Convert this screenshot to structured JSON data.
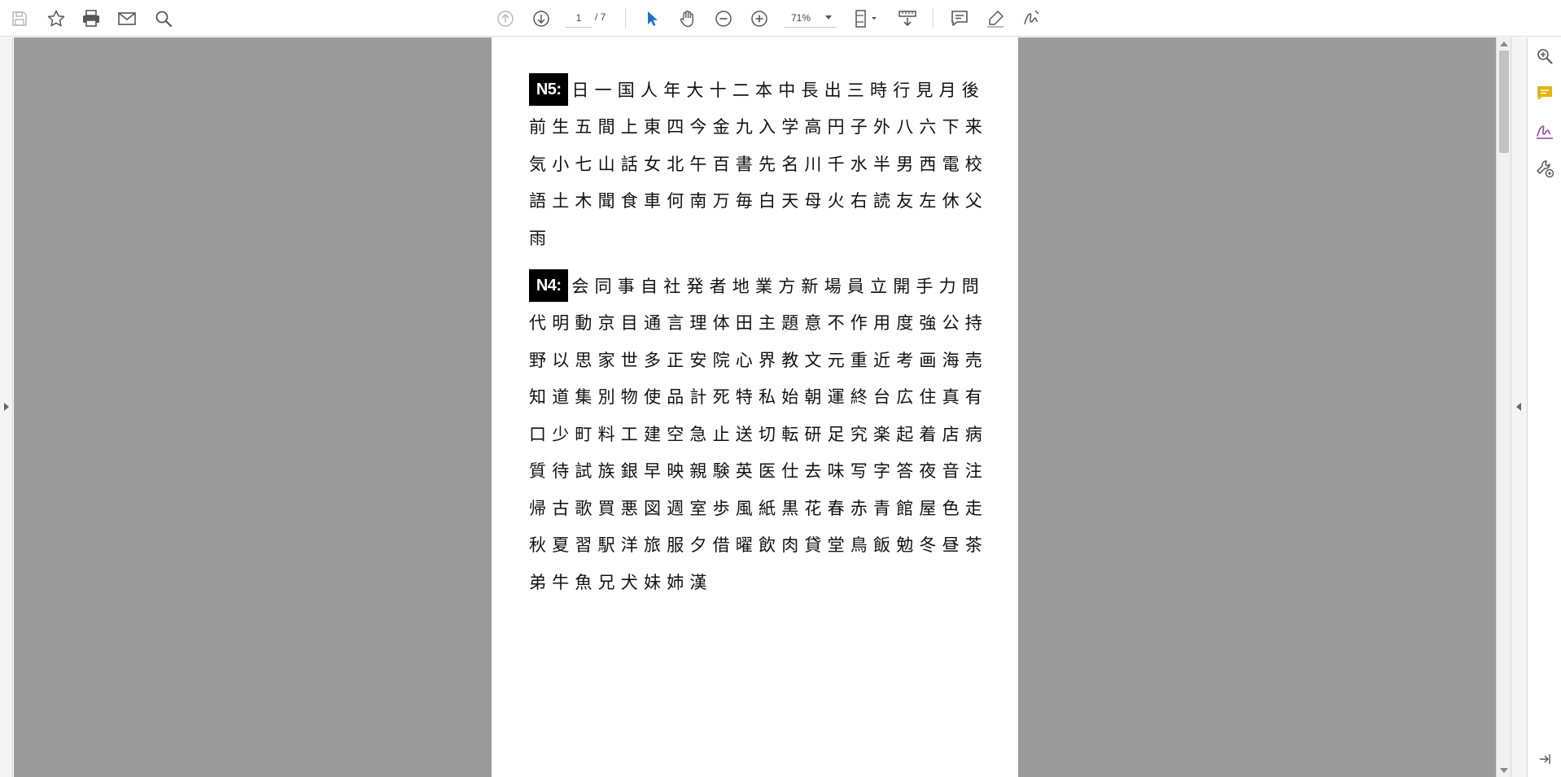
{
  "toolbar": {
    "page_current": "1",
    "page_total": "/ 7",
    "zoom": "71%"
  },
  "icons": {
    "save": "save-icon",
    "bookmark": "star-icon",
    "print": "printer-icon",
    "email": "envelope-icon",
    "search": "magnifier-icon",
    "prev_page": "arrow-up-circle-icon",
    "next_page": "arrow-down-circle-icon",
    "select": "cursor-arrow-icon",
    "hand": "hand-icon",
    "zoom_out": "minus-circle-icon",
    "zoom_in": "plus-circle-icon",
    "fit": "fit-page-icon",
    "scroll_mode": "scroll-mode-icon",
    "comment": "comment-icon",
    "highlight": "pen-icon",
    "sign": "sign-icon"
  },
  "colors": {
    "select_accent": "#2b6cc4",
    "comment_accent": "#e8b400",
    "sign_accent": "#8e44ad"
  },
  "document": {
    "sections": [
      {
        "badge": "N5:",
        "rows": [
          "日一国人年大十二本中長出三時行見月後",
          "前生五間上東四今金九入学高円子外八六下来",
          "気小七山話女北午百書先名川千水半男西電校",
          "語土木聞食車何南万毎白天母火右読友左休父",
          "雨"
        ]
      },
      {
        "badge": "N4:",
        "rows": [
          "会同事自社発者地業方新場員立開手力問",
          "代明動京目通言理体田主題意不作用度強公持",
          "野以思家世多正安院心界教文元重近考画海売",
          "知道集別物使品計死特私始朝運終台広住真有",
          "口少町料工建空急止送切転研足究楽起着店病",
          "質待試族銀早映親験英医仕去味写字答夜音注",
          "帰古歌買悪図週室歩風紙黒花春赤青館屋色走",
          "秋夏習駅洋旅服夕借曜飲肉貸堂鳥飯勉冬昼茶",
          "弟牛魚兄犬妹姉漢"
        ]
      }
    ]
  }
}
